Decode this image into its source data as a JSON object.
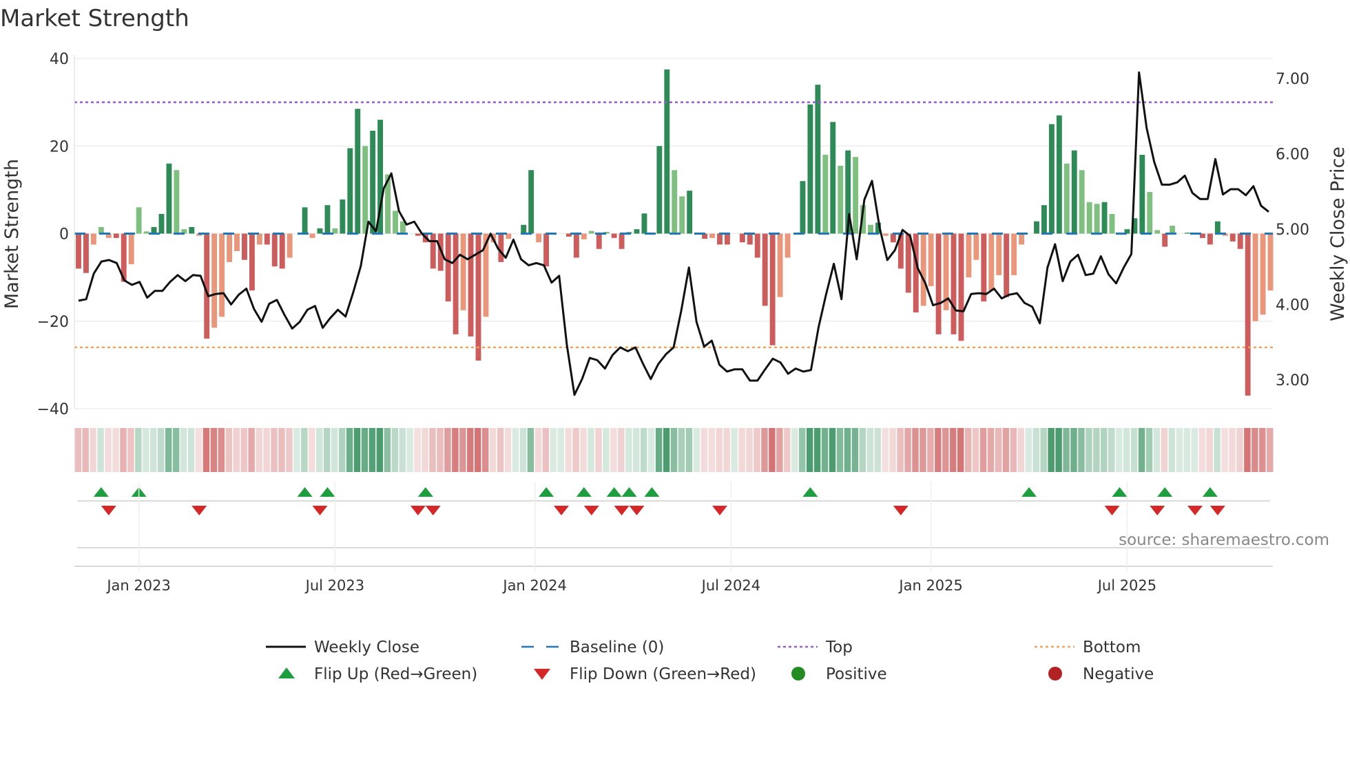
{
  "chart_data": {
    "type": "bar",
    "title": "Market Strength",
    "ylabel": "Market Strength",
    "y2label": "Weekly Close Price",
    "ylim": [
      -40,
      40
    ],
    "y2lim": [
      2.75,
      7.25
    ],
    "yticks": [
      "40",
      "20",
      "0",
      "−20",
      "−40"
    ],
    "ytick_values": [
      40,
      20,
      0,
      -20,
      -40
    ],
    "y2ticks": [
      "7.00",
      "6.00",
      "5.00",
      "4.00",
      "3.00"
    ],
    "y2tick_values": [
      7,
      6,
      5,
      4,
      3
    ],
    "xticks": [
      "Jan 2023",
      "Jul 2023",
      "Jan 2024",
      "Jul 2024",
      "Jan 2025",
      "Jul 2025"
    ],
    "xtick_week_index": [
      9,
      35,
      61.5,
      87.5,
      114,
      140
    ],
    "top_level": 30,
    "bottom_level": -26,
    "grid": true,
    "strength": [
      -8,
      -9,
      -2.5,
      1.5,
      -1,
      -1,
      -11,
      -7,
      6,
      0.5,
      1.5,
      4.5,
      16,
      14.5,
      1,
      1.5,
      -0.5,
      -24,
      -21.5,
      -19,
      -6.5,
      -4,
      -6,
      -13,
      -2.5,
      -2.5,
      -7.5,
      -8,
      -5.5,
      0,
      6,
      -1,
      1.2,
      6.5,
      1.2,
      7.8,
      19.5,
      28.5,
      20,
      23.5,
      26,
      13.5,
      5.2,
      2.8,
      0,
      -0.5,
      -2,
      -8,
      -8.5,
      -15.5,
      -23,
      -17.5,
      -23.5,
      -29,
      -19,
      -2,
      -6.5,
      -1.2,
      0,
      2,
      14.5,
      -2,
      -7.5,
      0,
      0,
      -0.7,
      -5.5,
      -1.3,
      0.6,
      -3.5,
      0.4,
      -1,
      -3.5,
      0.4,
      1,
      4.6,
      0,
      20,
      37.5,
      14.5,
      8.5,
      9.8,
      0,
      -1.2,
      -1,
      -2.5,
      -2.5,
      0,
      -2,
      -2.5,
      -5.5,
      -16.5,
      -25.5,
      -14.5,
      -5.5,
      0,
      12,
      29.5,
      34,
      18,
      25.5,
      15.5,
      19,
      17.5,
      6.5,
      2,
      2.5,
      -0.5,
      -2,
      -8,
      -13.5,
      -18,
      -16.5,
      -12,
      -23,
      -17.5,
      -23,
      -24.5,
      -10,
      -6,
      -15.5,
      -13,
      -9.5,
      -14.5,
      -9.5,
      -2.5,
      0,
      2.8,
      6.5,
      25,
      27,
      16,
      19,
      14.5,
      7.2,
      6.8,
      7.2,
      4.5,
      0,
      1,
      3.5,
      18,
      9.5,
      0.8,
      -3,
      1.8,
      0,
      0.2,
      0,
      -1,
      -2.5,
      2.8,
      -0.5,
      -1.8,
      -3.5,
      -37,
      -20,
      -18.5,
      -13
    ],
    "weekly_close": [
      4.05,
      4.07,
      4.41,
      4.57,
      4.59,
      4.55,
      4.32,
      4.26,
      4.3,
      4.09,
      4.18,
      4.18,
      4.3,
      4.39,
      4.31,
      4.39,
      4.38,
      4.11,
      4.14,
      4.15,
      4.0,
      4.13,
      4.21,
      3.94,
      3.77,
      4.01,
      4.06,
      3.86,
      3.68,
      3.77,
      3.93,
      3.98,
      3.69,
      3.82,
      3.93,
      3.84,
      4.16,
      4.51,
      5.1,
      4.97,
      5.54,
      5.74,
      5.24,
      5.06,
      5.1,
      4.94,
      4.84,
      4.84,
      4.6,
      4.55,
      4.66,
      4.6,
      4.66,
      4.72,
      4.94,
      4.74,
      4.62,
      4.86,
      4.6,
      4.52,
      4.55,
      4.52,
      4.29,
      4.38,
      3.47,
      2.8,
      3.01,
      3.29,
      3.26,
      3.15,
      3.33,
      3.43,
      3.38,
      3.43,
      3.21,
      3.01,
      3.21,
      3.34,
      3.43,
      3.92,
      4.49,
      3.77,
      3.44,
      3.52,
      3.2,
      3.11,
      3.14,
      3.14,
      2.99,
      2.99,
      3.14,
      3.28,
      3.23,
      3.08,
      3.15,
      3.11,
      3.13,
      3.7,
      4.14,
      4.54,
      4.07,
      5.2,
      4.6,
      5.39,
      5.64,
      5.02,
      4.59,
      4.72,
      4.99,
      4.91,
      4.48,
      4.28,
      3.99,
      4.02,
      4.08,
      3.92,
      3.91,
      4.14,
      4.15,
      4.14,
      4.21,
      4.08,
      4.13,
      4.15,
      4.02,
      3.97,
      3.75,
      4.49,
      4.8,
      4.31,
      4.57,
      4.66,
      4.39,
      4.41,
      4.64,
      4.4,
      4.28,
      4.49,
      4.67,
      7.08,
      6.34,
      5.89,
      5.59,
      5.59,
      5.62,
      5.71,
      5.48,
      5.4,
      5.4,
      5.93,
      5.46,
      5.53,
      5.53,
      5.45,
      5.57,
      5.31,
      5.23
    ],
    "flip_up_weeks": [
      4,
      9,
      31,
      34,
      47,
      63,
      68,
      72,
      74,
      77,
      98,
      127,
      139,
      145,
      151
    ],
    "flip_down_weeks": [
      5,
      17,
      33,
      46,
      48,
      65,
      69,
      73,
      75,
      86,
      110,
      138,
      144,
      149,
      152
    ],
    "legend": {
      "placement": "bottom",
      "items": [
        {
          "label": "Weekly Close",
          "kind": "line"
        },
        {
          "label": "Baseline (0)",
          "kind": "dash"
        },
        {
          "label": "Top",
          "kind": "dot-purple"
        },
        {
          "label": "Bottom",
          "kind": "dot-orange"
        },
        {
          "label": "Flip Up (Red→Green)",
          "kind": "tri-up"
        },
        {
          "label": "Flip Down (Green→Red)",
          "kind": "tri-down"
        },
        {
          "label": "Positive",
          "kind": "circle-green"
        },
        {
          "label": "Negative",
          "kind": "circle-red"
        }
      ]
    },
    "source": "source: sharemaestro.com"
  },
  "colors": {
    "pos_strong": "#2e8b57",
    "pos_weak": "#7fbf7f",
    "neg_strong": "#cd5c5c",
    "neg_weak": "#e9967a",
    "baseline": "#1f77b4",
    "top": "#9b59d6",
    "bottom": "#f0a35e",
    "price": "#111111",
    "flip_up": "#1e9e3e",
    "flip_down": "#d62728",
    "positive": "#228b22",
    "negative": "#b22222"
  }
}
